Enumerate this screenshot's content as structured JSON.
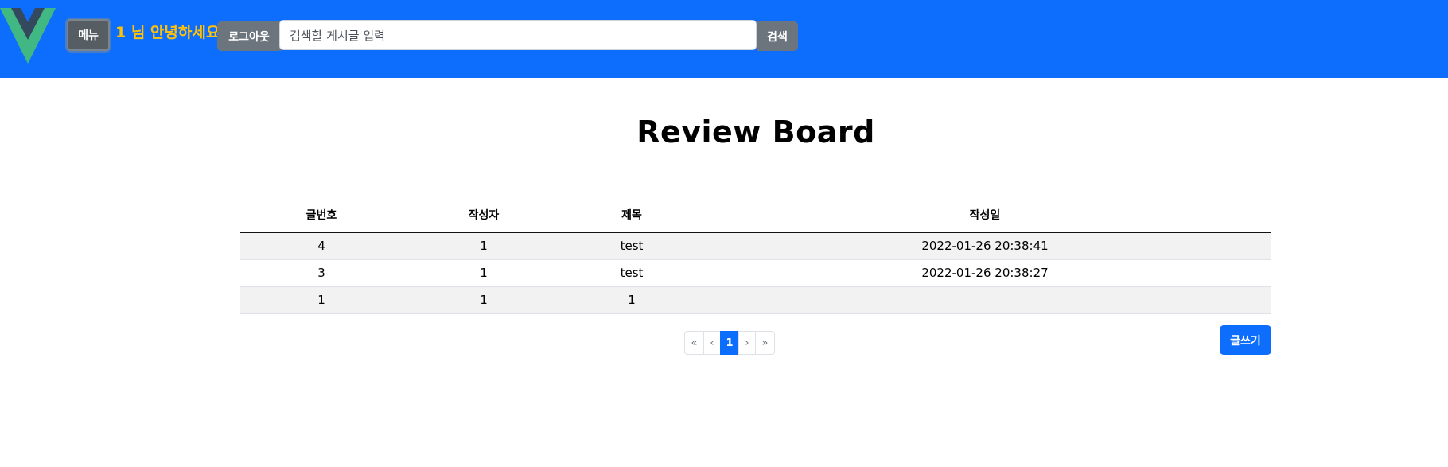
{
  "header": {
    "menu_label": "메뉴",
    "greeting": "1 님 안녕하세요",
    "logout_label": "로그아웃",
    "search_placeholder": "검색할 게시글 입력",
    "search_label": "검색"
  },
  "main": {
    "title": "Review Board",
    "columns": [
      "글번호",
      "작성자",
      "제목",
      "작성일"
    ],
    "rows": [
      {
        "no": "4",
        "author": "1",
        "subject": "test",
        "date": "2022-01-26 20:38:41"
      },
      {
        "no": "3",
        "author": "1",
        "subject": "test",
        "date": "2022-01-26 20:38:27"
      },
      {
        "no": "1",
        "author": "1",
        "subject": "1",
        "date": ""
      }
    ],
    "pagination": {
      "first": "«",
      "prev": "‹",
      "current": "1",
      "next": "›",
      "last": "»"
    },
    "write_label": "글쓰기"
  },
  "colors": {
    "navbar": "#0d6efd",
    "greeting": "#ffc107",
    "secondary_button": "#6c757d",
    "primary_button": "#0d6efd",
    "logo_green": "#41b883",
    "logo_dark": "#34495e"
  }
}
